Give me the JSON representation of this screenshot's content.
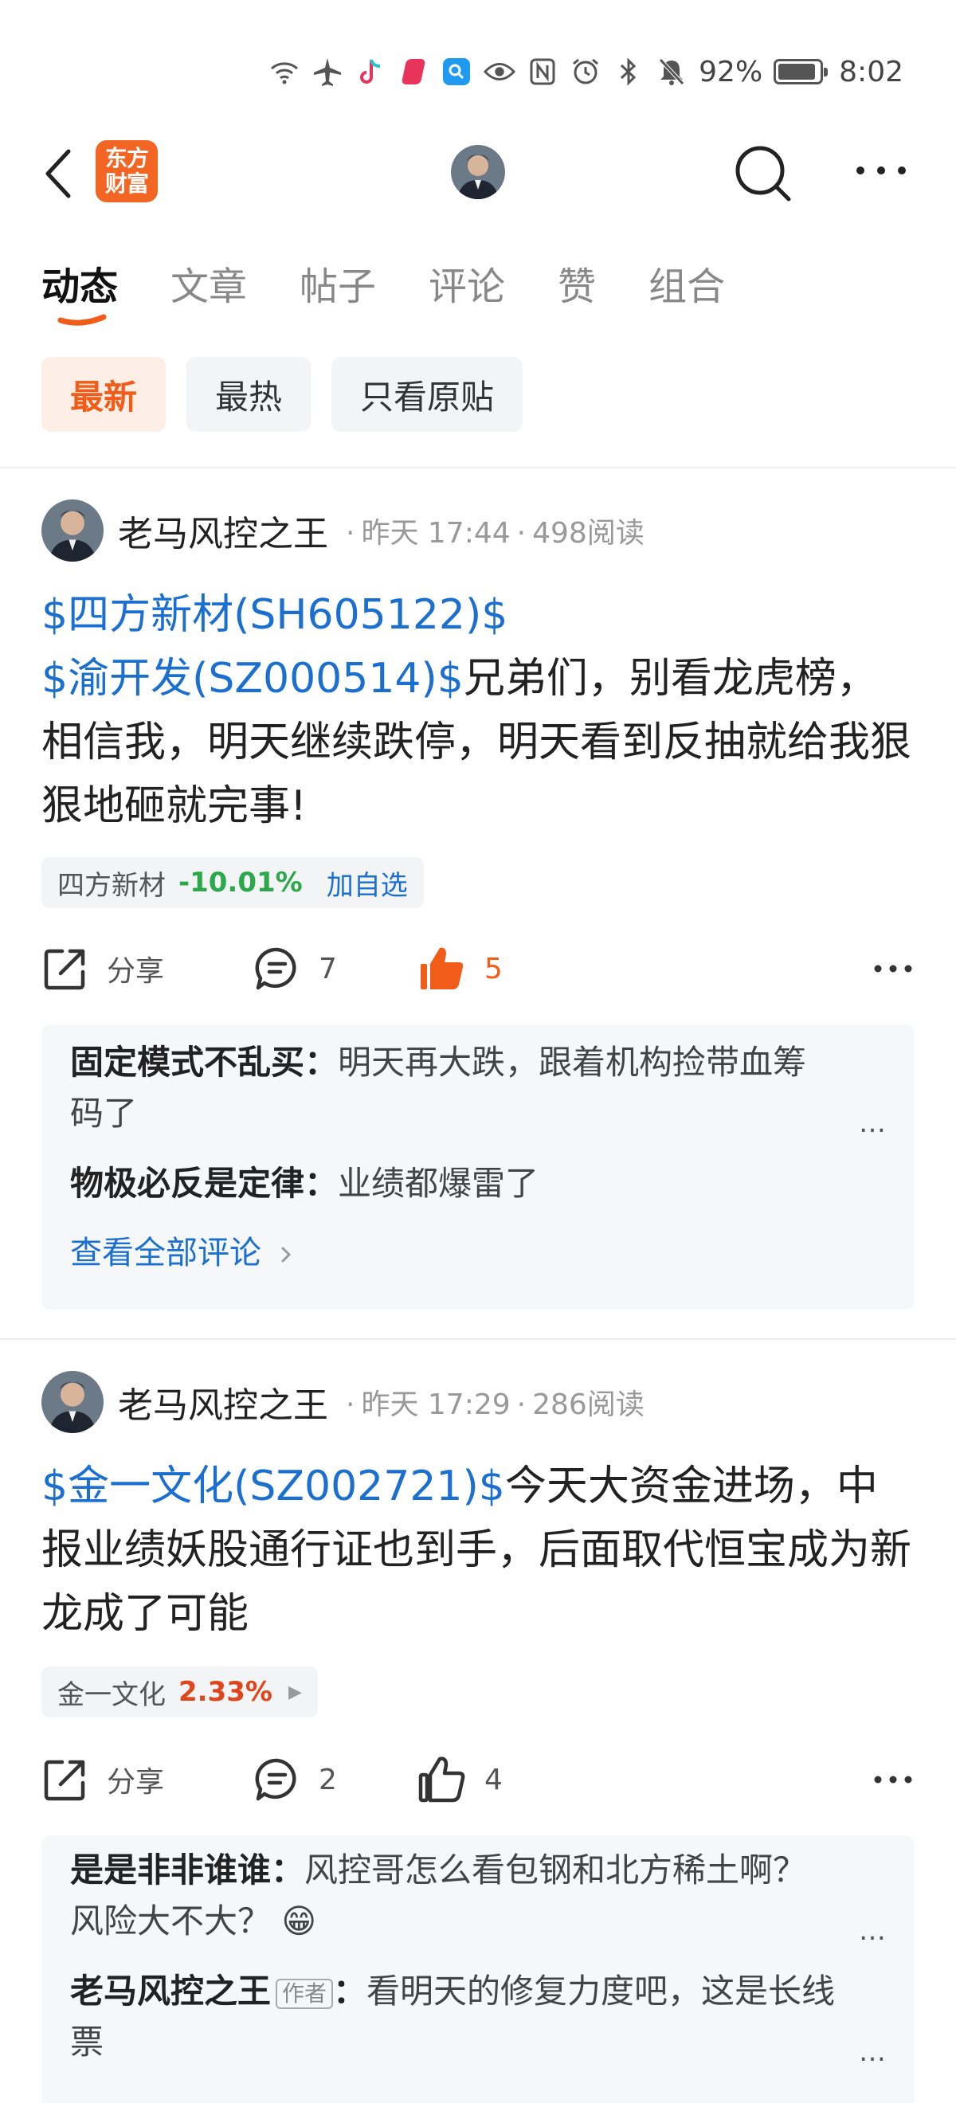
{
  "status_bar": {
    "battery": "92%",
    "battery_level": 0.92,
    "time": "8:02"
  },
  "header": {
    "logo_line1": "东方",
    "logo_line2": "财富",
    "icons": [
      "back-icon",
      "search-icon",
      "more-icon"
    ]
  },
  "tabs": [
    {
      "label": "动态",
      "active": true
    },
    {
      "label": "文章"
    },
    {
      "label": "帖子"
    },
    {
      "label": "评论"
    },
    {
      "label": "赞"
    },
    {
      "label": "组合"
    }
  ],
  "filters": [
    {
      "label": "最新",
      "active": true
    },
    {
      "label": "最热"
    },
    {
      "label": "只看原贴"
    }
  ],
  "posts": [
    {
      "author": "老马风控之王",
      "time": "昨天 17:44",
      "reads": "498阅读",
      "stock1": "$四方新材(SH605122)$",
      "stock2": "$渝开发(SZ000514)$",
      "text": "兄弟们，别看龙虎榜，相信我，明天继续跌停，明天看到反抽就给我狠狠地砸就完事!",
      "tag_name": "四方新材",
      "tag_pct": "-10.01%",
      "tag_add": "加自选",
      "share": "分享",
      "comment_count": "7",
      "like_count": "5",
      "comments": [
        {
          "who": "固定模式不乱买",
          "sep": "：",
          "text": "明天再大跌，跟着机构捡带血筹码了"
        },
        {
          "who": "物极必反是定律",
          "sep": "：",
          "text": "业绩都爆雷了"
        }
      ],
      "see_all": "查看全部评论"
    },
    {
      "author": "老马风控之王",
      "time": "昨天 17:29",
      "reads": "286阅读",
      "stock1": "$金一文化(SZ002721)$",
      "text": "今天大资金进场，中报业绩妖股通行证也到手，后面取代恒宝成为新龙成了可能",
      "tag_name": "金一文化",
      "tag_pct": "2.33%",
      "share": "分享",
      "comment_count": "2",
      "like_count": "4",
      "comments": [
        {
          "who": "是是非非谁谁",
          "sep": "：",
          "text": "风控哥怎么看包钢和北方稀土啊？风险大不大？",
          "emoji": "😁"
        },
        {
          "who": "老马风控之王",
          "badge": "作者",
          "sep": "：",
          "text": "看明天的修复力度吧，这是长线票"
        }
      ]
    }
  ],
  "colors": {
    "accent": "#f25c19",
    "link": "#1a6fd0",
    "down": "#2aa84a",
    "up": "#e0461b"
  }
}
